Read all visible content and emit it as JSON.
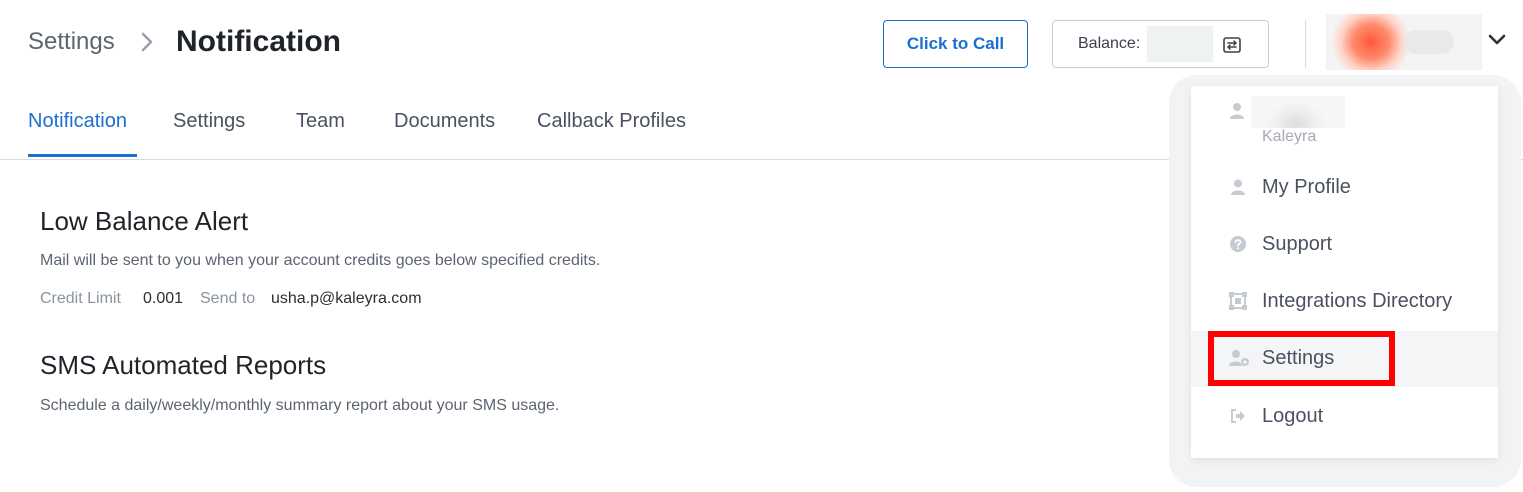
{
  "header": {
    "breadcrumb_parent": "Settings",
    "breadcrumb_current": "Notification",
    "call_button_label": "Click to Call",
    "balance_label": "Balance:"
  },
  "tabs": [
    {
      "label": "Notification",
      "active": true
    },
    {
      "label": "Settings",
      "active": false
    },
    {
      "label": "Team",
      "active": false
    },
    {
      "label": "Documents",
      "active": false
    },
    {
      "label": "Callback Profiles",
      "active": false
    }
  ],
  "low_balance": {
    "title": "Low Balance Alert",
    "description": "Mail will be sent to you when your account credits goes below specified credits.",
    "credit_limit_label": "Credit Limit",
    "credit_limit_value": "0.001",
    "send_to_label": "Send to",
    "send_to_value": "usha.p@kaleyra.com"
  },
  "sms_reports": {
    "title": "SMS Automated Reports",
    "description": "Schedule a daily/weekly/monthly summary report about your SMS usage."
  },
  "dropdown": {
    "org": "Kaleyra",
    "items": [
      {
        "label": "My Profile",
        "icon": "user-icon"
      },
      {
        "label": "Support",
        "icon": "help-icon"
      },
      {
        "label": "Integrations Directory",
        "icon": "integrations-icon"
      },
      {
        "label": "Settings",
        "icon": "user-settings-icon",
        "highlighted": true
      },
      {
        "label": "Logout",
        "icon": "logout-icon"
      }
    ]
  },
  "colors": {
    "accent": "#1a6fd0",
    "highlight": "#ff0000",
    "text_muted": "#8a93a0"
  }
}
